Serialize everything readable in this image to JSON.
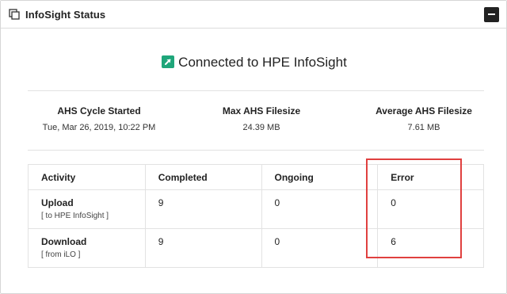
{
  "panel": {
    "title": "InfoSight Status",
    "icons": {
      "header": "copy-icon",
      "collapse": "minus-icon",
      "status": "external-link-arrow-icon"
    },
    "colors": {
      "status_icon": "#1fa67a",
      "collapse_button": "#222222",
      "highlight": "#e0403f"
    }
  },
  "status": {
    "text": "Connected to HPE InfoSight"
  },
  "stats": [
    {
      "label": "AHS Cycle Started",
      "value": "Tue, Mar 26, 2019, 10:22 PM"
    },
    {
      "label": "Max AHS Filesize",
      "value": "24.39 MB"
    },
    {
      "label": "Average AHS Filesize",
      "value": "7.61 MB"
    }
  ],
  "table": {
    "headers": [
      "Activity",
      "Completed",
      "Ongoing",
      "Error"
    ],
    "rows": [
      {
        "activity": "Upload",
        "detail": "[ to HPE InfoSight ]",
        "completed": "9",
        "ongoing": "0",
        "error": "0"
      },
      {
        "activity": "Download",
        "detail": "[ from iLO ]",
        "completed": "9",
        "ongoing": "0",
        "error": "6"
      }
    ]
  }
}
